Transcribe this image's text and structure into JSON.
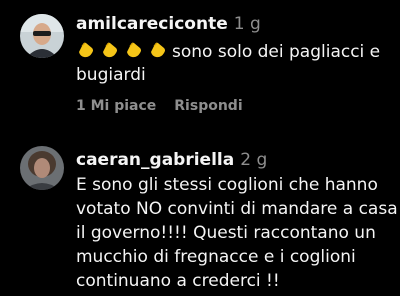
{
  "comments": [
    {
      "username": "amilcareciconte",
      "time": "1 g",
      "emoji": "clapping-hands-icon",
      "text_line1": "sono solo dei pagliacci e",
      "text_line2": "bugiardi",
      "likes": "1 Mi piace",
      "reply": "Rispondi"
    },
    {
      "username": "caeran_gabriella",
      "time": "2 g",
      "lines": [
        "E sono gli stessi coglioni che hanno",
        "votato NO convinti di mandare a casa",
        "il governo!!!! Questi raccontano un",
        "mucchio di fregnacce e i coglioni",
        "continuano a crederci !!"
      ]
    }
  ],
  "colors": {
    "background": "#000000",
    "text": "#f5f5f5",
    "secondary": "#8e8e8e",
    "emoji": "#f5c518"
  }
}
